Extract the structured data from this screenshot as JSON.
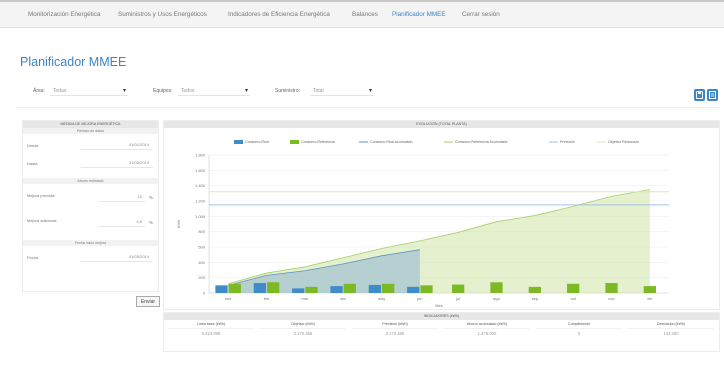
{
  "nav": {
    "items": [
      "Monitorización Energética",
      "Suministros y Usos Energéticos",
      "Indicadores de Eficiencia Energética",
      "Balances",
      "Planificador MMEE",
      "Cerrar sesión"
    ],
    "active": "Planificador MMEE"
  },
  "page": {
    "title": "Planificador MMEE"
  },
  "filters": {
    "area": {
      "label": "Área:",
      "value": "Todas"
    },
    "equipos": {
      "label": "Equipos:",
      "value": "Todos"
    },
    "suministro": {
      "label": "Suministro:",
      "value": "Total"
    }
  },
  "actions": {
    "icon1": "save-icon",
    "icon2": "print-icon"
  },
  "left_panel": {
    "title": "MEDIDA DE MEJORA ENERGÉTICA",
    "periodo": {
      "title": "Periodo de datos",
      "desde_label": "Desde",
      "desde_value": "01/01/2014",
      "hasta_label": "Hasta",
      "hasta_value": "31/05/2014"
    },
    "ahorro": {
      "title": "Ahorro estimado",
      "mejora_prevista_label": "Mejora prevista:",
      "mejora_prevista_value": "10",
      "mejora_adicional_label": "Mejora adicional:",
      "mejora_adicional_value": "0,5",
      "unit": "%"
    },
    "fecha": {
      "title": "Fecha inicio mejora",
      "fecha_label": "Fecha",
      "fecha_value": "01/05/2014"
    },
    "submit_label": "Enviar"
  },
  "chart_panel": {
    "title": "EVOLUCIÓN (TOTAL PLANTA)"
  },
  "chart_data": {
    "type": "bar",
    "title": "EVOLUCIÓN (TOTAL PLANTA)",
    "xlabel": "Mes",
    "ylabel": "kWh",
    "categories": [
      "ene",
      "feb",
      "mar",
      "abr",
      "may",
      "jun",
      "jul",
      "ago",
      "sep",
      "oct",
      "nov",
      "dic"
    ],
    "ylim": [
      0,
      1800
    ],
    "yticks": [
      "0",
      "200",
      "400",
      "600",
      "800",
      "1.000",
      "1.200",
      "1.400",
      "1.600",
      "1.800"
    ],
    "legend_position": "top",
    "series": [
      {
        "name": "Consumo Real",
        "kind": "bar",
        "color": "#3f8ccb",
        "values": [
          100,
          130,
          60,
          90,
          105,
          80,
          null,
          null,
          null,
          null,
          null,
          null
        ]
      },
      {
        "name": "Consumo Referencia",
        "kind": "bar",
        "color": "#7cb925",
        "values": [
          120,
          140,
          80,
          120,
          120,
          100,
          110,
          140,
          80,
          120,
          130,
          90
        ]
      },
      {
        "name": "Consumo Real Acumulado",
        "kind": "area",
        "color": "#8fb5d1",
        "values": [
          100,
          230,
          290,
          380,
          485,
          565,
          null,
          null,
          null,
          null,
          null,
          null
        ]
      },
      {
        "name": "Consumo Referencia Acumulado",
        "kind": "area",
        "color": "#cfe3a8",
        "values": [
          120,
          260,
          340,
          460,
          580,
          680,
          790,
          930,
          1010,
          1130,
          1260,
          1350
        ]
      },
      {
        "name": "Previsión",
        "kind": "line",
        "color": "#9fc3e0",
        "values": [
          1150,
          1150,
          1150,
          1150,
          1150,
          1150,
          1150,
          1150,
          1150,
          1150,
          1150,
          1150
        ]
      },
      {
        "name": "Objetivo Reducción",
        "kind": "line",
        "color": "#d9e9b4",
        "values": [
          1320,
          1320,
          1320,
          1320,
          1320,
          1320,
          1320,
          1320,
          1320,
          1320,
          1320,
          1320
        ]
      }
    ]
  },
  "indicators": {
    "title": "INDICADORES (kWh)",
    "columns": [
      {
        "header": "Línea base (kWh)",
        "value": "3.424.999"
      },
      {
        "header": "Objetivo (kWh)",
        "value": "3.172.465"
      },
      {
        "header": "Previsión (kWh)",
        "value": "3.172.465"
      },
      {
        "header": "Ahorro acumulado (kWh)",
        "value": "1.476.000"
      },
      {
        "header": "Cumplimiento",
        "value": "0"
      },
      {
        "header": "Desviación (kWh)",
        "value": "142.000"
      }
    ]
  }
}
